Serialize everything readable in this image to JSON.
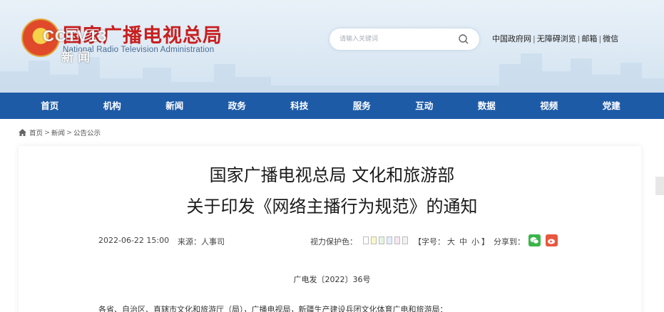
{
  "header": {
    "site_title": "国家广播电视总局",
    "site_subtitle": "National Radio Television Administration",
    "watermark_logo": "CCTV13",
    "watermark_sub": "新闻",
    "search_placeholder": "请输入关键词",
    "top_links": [
      "中国政府网",
      "无障碍浏览",
      "邮箱",
      "微信"
    ]
  },
  "nav": {
    "items": [
      "首页",
      "机构",
      "新闻",
      "政务",
      "科技",
      "服务",
      "互动",
      "数据",
      "视频",
      "党建"
    ]
  },
  "breadcrumb": {
    "items": [
      "首页",
      "新闻",
      "公告公示"
    ]
  },
  "article": {
    "title_line1": "国家广播电视总局 文化和旅游部",
    "title_line2": "关于印发《网络主播行为规范》的通知",
    "date": "2022-06-22 15:00",
    "source": "来源：人事司",
    "eye_protection_label": "视力保护色：",
    "eye_colors": [
      "#ffffff",
      "#fff7c6",
      "#e7f4e4",
      "#e3eefb",
      "#f6e7f1",
      "#f2f2f2"
    ],
    "font_size_open": "【字号：",
    "font_sizes": [
      "大",
      "中",
      "小"
    ],
    "font_size_close": "】",
    "share_label": "分享到：",
    "doc_number": "广电发〔2022〕36号",
    "body_first_line": "各省、自治区、直辖市文化和旅游厅（局），广播电视局，新疆生产建设兵团文化体育广电和旅游局："
  },
  "colors": {
    "nav_bg": "#1e5ba7",
    "title_red": "#c81f1f",
    "wechat": "#3bb54a",
    "weibo": "#e8573f"
  }
}
